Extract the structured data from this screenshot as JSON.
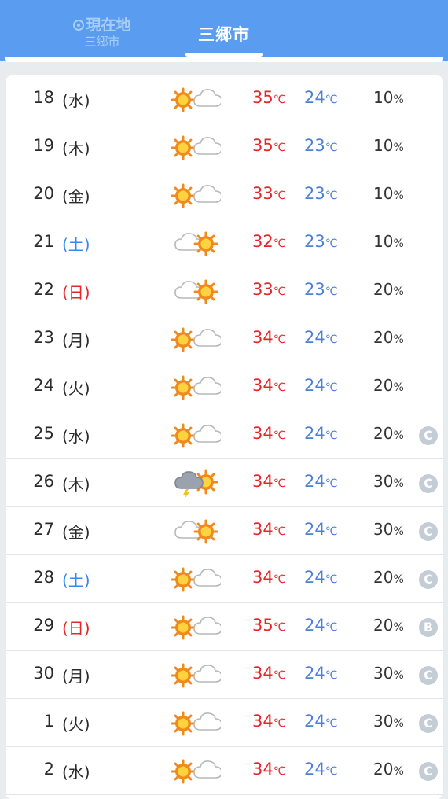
{
  "header": {
    "location_tab": {
      "label": "現在地",
      "sublabel": "三郷市"
    },
    "city_tab": {
      "label": "三郷市"
    }
  },
  "forecast": [
    {
      "day": "18",
      "dow": "(水)",
      "dow_type": "weekday",
      "icon": "sun-cloud-icon",
      "high": "35",
      "low": "24",
      "precip": "10",
      "badge": ""
    },
    {
      "day": "19",
      "dow": "(木)",
      "dow_type": "weekday",
      "icon": "sun-cloud-icon",
      "high": "35",
      "low": "23",
      "precip": "10",
      "badge": ""
    },
    {
      "day": "20",
      "dow": "(金)",
      "dow_type": "weekday",
      "icon": "sun-cloud-icon",
      "high": "33",
      "low": "23",
      "precip": "10",
      "badge": ""
    },
    {
      "day": "21",
      "dow": "(土)",
      "dow_type": "sat",
      "icon": "cloud-sun-icon",
      "high": "32",
      "low": "23",
      "precip": "10",
      "badge": ""
    },
    {
      "day": "22",
      "dow": "(日)",
      "dow_type": "sun",
      "icon": "cloud-sun-icon",
      "high": "33",
      "low": "23",
      "precip": "20",
      "badge": ""
    },
    {
      "day": "23",
      "dow": "(月)",
      "dow_type": "weekday",
      "icon": "sun-cloud-icon",
      "high": "34",
      "low": "24",
      "precip": "20",
      "badge": ""
    },
    {
      "day": "24",
      "dow": "(火)",
      "dow_type": "weekday",
      "icon": "sun-cloud-icon",
      "high": "34",
      "low": "24",
      "precip": "20",
      "badge": ""
    },
    {
      "day": "25",
      "dow": "(水)",
      "dow_type": "weekday",
      "icon": "sun-cloud-icon",
      "high": "34",
      "low": "24",
      "precip": "20",
      "badge": "C"
    },
    {
      "day": "26",
      "dow": "(木)",
      "dow_type": "weekday",
      "icon": "thunder-sun-icon",
      "high": "34",
      "low": "24",
      "precip": "30",
      "badge": "C"
    },
    {
      "day": "27",
      "dow": "(金)",
      "dow_type": "weekday",
      "icon": "cloud-sun-icon",
      "high": "34",
      "low": "24",
      "precip": "30",
      "badge": "C"
    },
    {
      "day": "28",
      "dow": "(土)",
      "dow_type": "sat",
      "icon": "sun-cloud-icon",
      "high": "34",
      "low": "24",
      "precip": "20",
      "badge": "C"
    },
    {
      "day": "29",
      "dow": "(日)",
      "dow_type": "sun",
      "icon": "sun-cloud-icon",
      "high": "35",
      "low": "24",
      "precip": "20",
      "badge": "B"
    },
    {
      "day": "30",
      "dow": "(月)",
      "dow_type": "weekday",
      "icon": "sun-cloud-icon",
      "high": "34",
      "low": "24",
      "precip": "30",
      "badge": "C"
    },
    {
      "day": "1",
      "dow": "(火)",
      "dow_type": "weekday",
      "icon": "sun-cloud-icon",
      "high": "34",
      "low": "24",
      "precip": "30",
      "badge": "C"
    },
    {
      "day": "2",
      "dow": "(水)",
      "dow_type": "weekday",
      "icon": "sun-cloud-icon",
      "high": "34",
      "low": "24",
      "precip": "20",
      "badge": "C"
    }
  ],
  "units": {
    "temp": "℃",
    "precip": "%"
  },
  "colors": {
    "header": "#5a9df0",
    "high": "#e8242b",
    "low": "#4f7fd6",
    "saturday": "#3e86e8",
    "sunday": "#e8242b",
    "sun": "#f08a1c",
    "badge": "#c4cdd6"
  }
}
